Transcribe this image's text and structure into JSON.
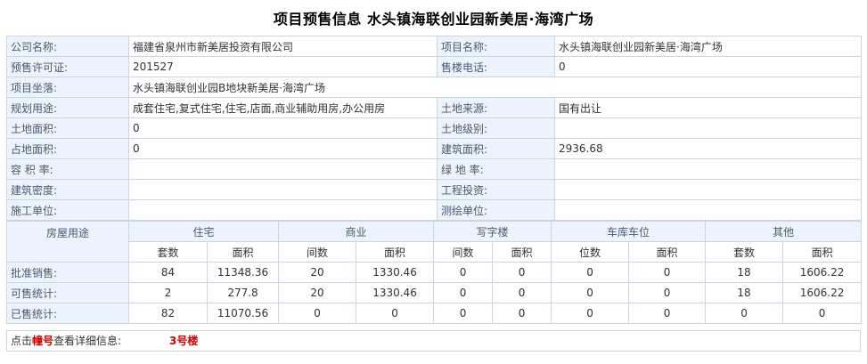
{
  "title": "项目预售信息  水头镇海联创业园新美居·海湾广场",
  "info_rows": [
    {
      "l1": "公司名称:",
      "v1": "福建省泉州市新美居投资有限公司",
      "l2": "项目名称:",
      "v2": "水头镇海联创业园新美居·海湾广场"
    },
    {
      "l1": "预售许可证:",
      "v1": "201527",
      "l2": "售楼电话:",
      "v2": "0"
    },
    {
      "l1": "项目坐落:",
      "v1": "水头镇海联创业园B地块新美居·海湾广场"
    },
    {
      "l1": "规划用途:",
      "v1": "成套住宅,复式住宅,住宅,店面,商业辅助用房,办公用房",
      "l2": "土地来源:",
      "v2": "国有出让"
    },
    {
      "l1": "土地面积:",
      "v1": "0",
      "l2": "土地级别:",
      "v2": ""
    },
    {
      "l1": "占地面积:",
      "v1": "0",
      "l2": "建筑面积:",
      "v2": "2936.68"
    },
    {
      "l1": "容 积 率:",
      "v1": "",
      "l2": "绿 地 率:",
      "v2": ""
    },
    {
      "l1": "建筑密度:",
      "v1": "",
      "l2": "工程投资:",
      "v2": ""
    },
    {
      "l1": "施工单位:",
      "v1": "",
      "l2": "测绘单位:",
      "v2": ""
    }
  ],
  "stats": {
    "usage_label": "房屋用途",
    "groups": [
      "住宅",
      "商业",
      "写字楼",
      "车库车位",
      "其他"
    ],
    "subheaders": [
      "套数",
      "面积",
      "间数",
      "面积",
      "间数",
      "面积",
      "位数",
      "面积",
      "套数",
      "面积"
    ],
    "rows": [
      {
        "label": "批准销售:",
        "values": [
          "84",
          "11348.36",
          "20",
          "1330.46",
          "0",
          "0",
          "0",
          "0",
          "18",
          "1606.22"
        ]
      },
      {
        "label": "可售统计:",
        "values": [
          "2",
          "277.8",
          "20",
          "1330.46",
          "0",
          "0",
          "0",
          "0",
          "18",
          "1606.22"
        ]
      },
      {
        "label": "已售统计:",
        "values": [
          "82",
          "11070.56",
          "0",
          "0",
          "0",
          "0",
          "0",
          "0",
          "0",
          "0"
        ]
      }
    ]
  },
  "footer": {
    "prefix": "点击",
    "highlight": "幢号",
    "suffix": "查看详细信息:",
    "building": "3号楼"
  }
}
